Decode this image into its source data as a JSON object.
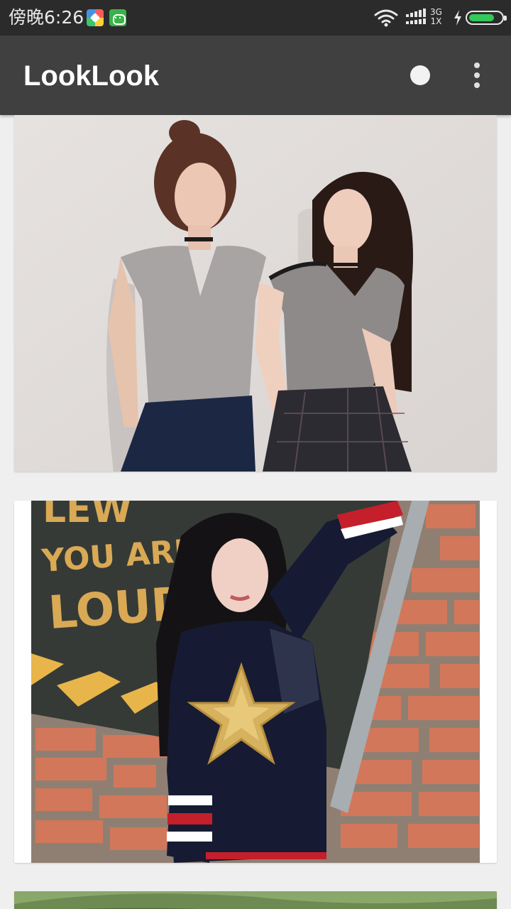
{
  "status_bar": {
    "time": "傍晚6:26",
    "network_top": "3G",
    "network_bottom": "1X",
    "icons": [
      "photos-app-icon",
      "android-app-icon",
      "wifi-icon",
      "signal-icon",
      "charging-icon",
      "battery-icon"
    ],
    "battery_level": 0.75
  },
  "app_bar": {
    "title": "LookLook",
    "background": "#404040",
    "actions": [
      "circle-icon",
      "more-vert-icon"
    ]
  },
  "feed": {
    "cards": [
      {
        "type": "photo",
        "subject": "two-girls-grey-tshirts"
      },
      {
        "type": "photo",
        "subject": "girl-star-sweater-brick-wall"
      },
      {
        "type": "photo",
        "subject": "outdoor-green-scene"
      }
    ]
  }
}
